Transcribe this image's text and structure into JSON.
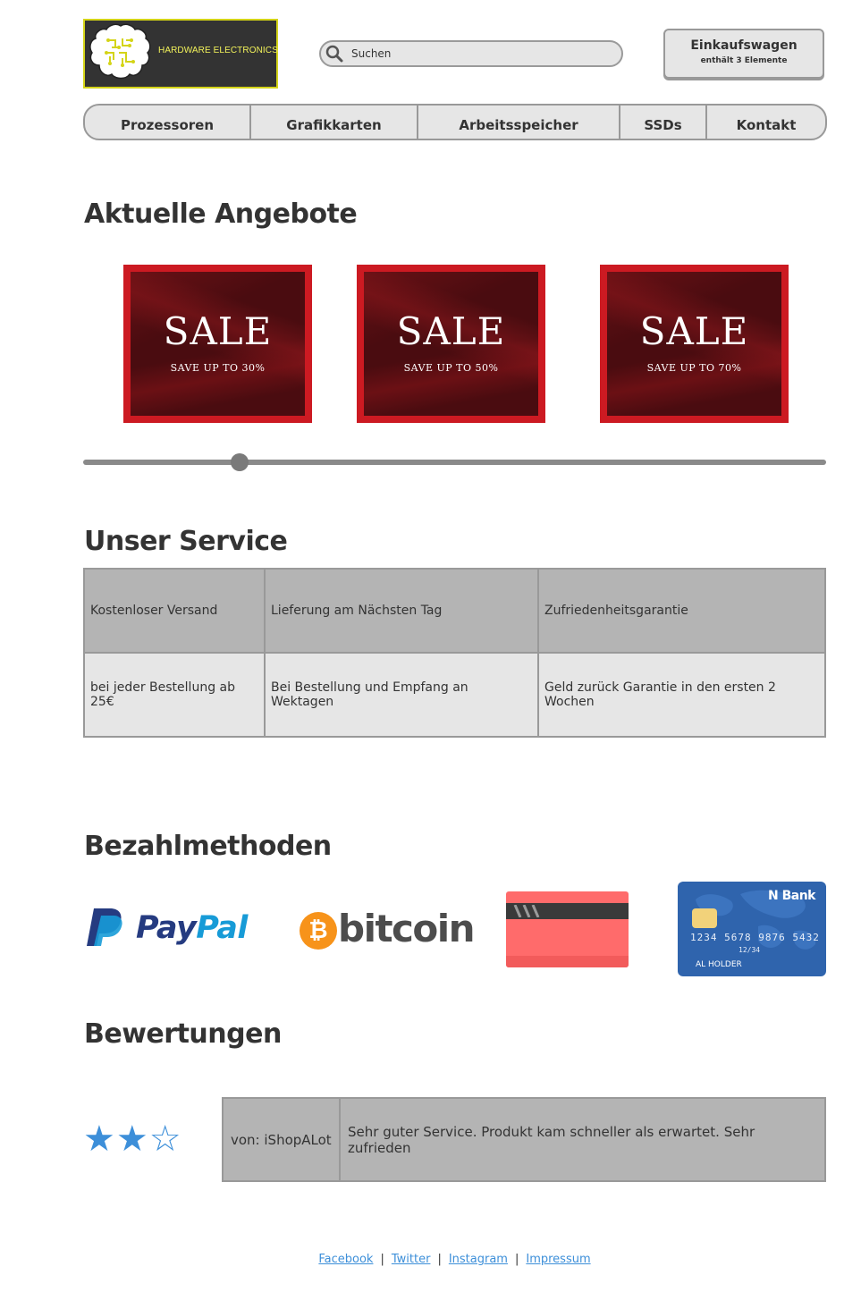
{
  "header": {
    "logo_text": "HARDWARE ELECTRONICS",
    "search_placeholder": "Suchen",
    "cart_title": "Einkaufswagen",
    "cart_subtitle": "enthält 3 Elemente"
  },
  "nav": [
    "Prozessoren",
    "Grafikkarten",
    "Arbeitsspeicher",
    "SSDs",
    "Kontakt"
  ],
  "offers": {
    "title": "Aktuelle Angebote",
    "banners": [
      {
        "title": "SALE",
        "subtitle": "SAVE UP TO 30%"
      },
      {
        "title": "SALE",
        "subtitle": "SAVE UP TO 50%"
      },
      {
        "title": "SALE",
        "subtitle": "SAVE UP TO 70%"
      }
    ],
    "slider_position": 0.21
  },
  "service": {
    "title": "Unser Service",
    "headers": [
      "Kostenloser Versand",
      "Lieferung am Nächsten Tag",
      "Zufriedenheitsgarantie"
    ],
    "details": [
      "bei jeder Bestellung ab 25€",
      "Bei Bestellung und Empfang an Wektagen",
      "Geld zurück Garantie in den ersten 2 Wochen"
    ]
  },
  "payment": {
    "title": "Bezahlmethoden",
    "paypal": {
      "pay": "Pay",
      "pal": "Pal"
    },
    "bitcoin": "bitcoin",
    "card": {
      "bank": "N Bank",
      "number": "1234  5678  9876  5432",
      "expiry": "12/34",
      "holder": "AL  HOLDER"
    }
  },
  "reviews": {
    "title": "Bewertungen",
    "rating": 2,
    "max_rating": 3,
    "author": "von: iShopALot",
    "text": "Sehr guter Service. Produkt kam schneller als erwartet. Sehr zufrieden"
  },
  "footer": {
    "links": [
      "Facebook",
      "Twitter",
      "Instagram",
      "Impressum"
    ],
    "separator": "|"
  },
  "colors": {
    "accent": "#3d8fd9",
    "sale_red": "#cc1a22",
    "text": "#333333",
    "panel": "#e6e6e6"
  }
}
